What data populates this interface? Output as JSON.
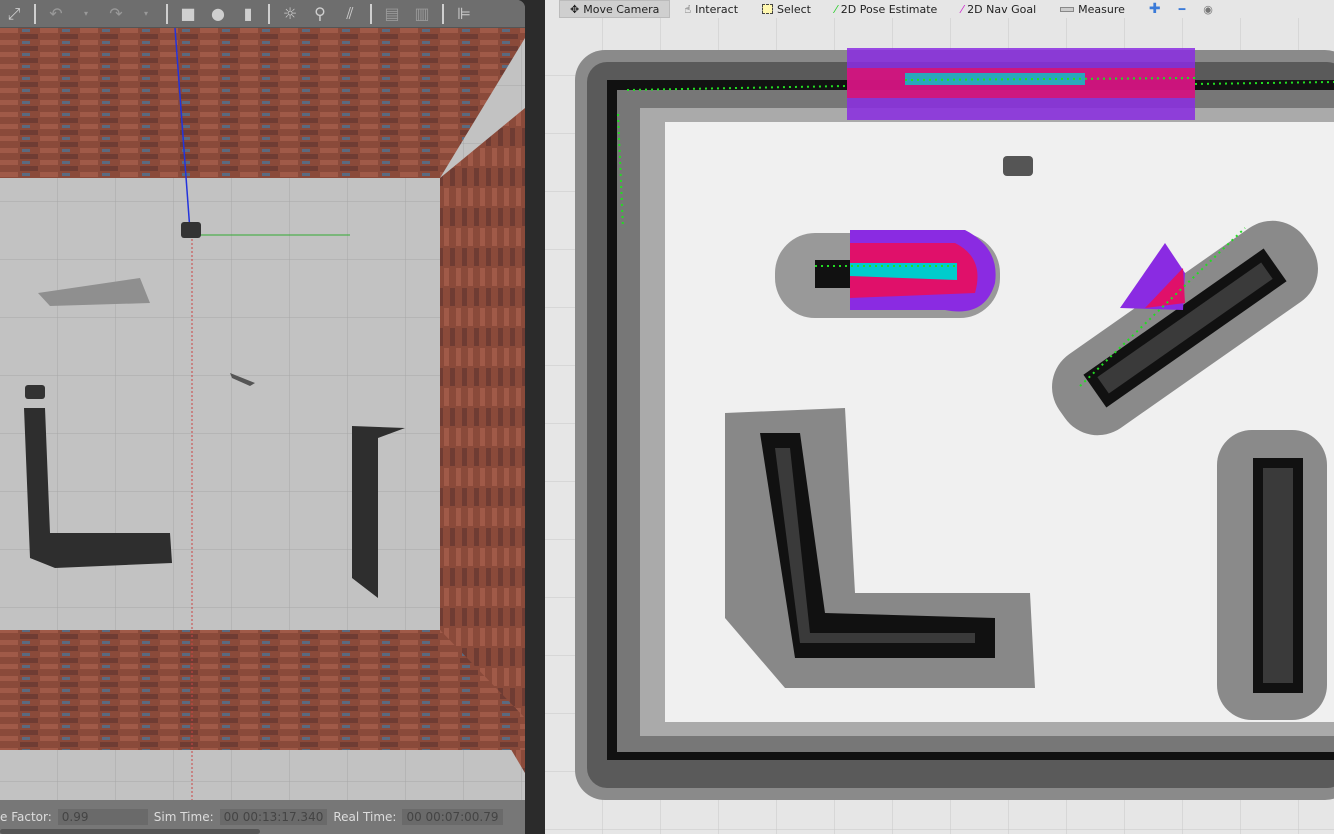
{
  "gazebo": {
    "toolbar": [
      {
        "icon": "fullscreen-icon"
      },
      {
        "icon": "undo-icon"
      },
      {
        "icon": "undo-dropdown-icon"
      },
      {
        "icon": "redo-icon"
      },
      {
        "icon": "redo-dropdown-icon"
      },
      {
        "icon": "box-icon"
      },
      {
        "icon": "sphere-icon"
      },
      {
        "icon": "cylinder-icon"
      },
      {
        "icon": "point-light-icon"
      },
      {
        "icon": "spot-light-icon"
      },
      {
        "icon": "directional-light-icon"
      },
      {
        "icon": "copy-icon"
      },
      {
        "icon": "paste-icon"
      },
      {
        "icon": "align-icon"
      }
    ],
    "status": {
      "rtf_label": "e Factor:",
      "rtf_value": "0.99",
      "sim_label": "Sim Time:",
      "sim_value": "00 00:13:17.340",
      "real_label": "Real Time:",
      "real_value": "00 00:07:00.79"
    }
  },
  "rviz": {
    "toolbar": [
      {
        "label": "Move Camera",
        "icon": "move-camera-icon",
        "active": true
      },
      {
        "label": "Interact",
        "icon": "hand-icon"
      },
      {
        "label": "Select",
        "icon": "select-icon"
      },
      {
        "label": "2D Pose Estimate",
        "icon": "pose-arrow-icon",
        "color": "#22cc22"
      },
      {
        "label": "2D Nav Goal",
        "icon": "goal-arrow-icon",
        "color": "#cc22cc"
      },
      {
        "label": "Measure",
        "icon": "ruler-icon"
      }
    ],
    "colors": {
      "costmap_high": "#ff0066",
      "costmap_mid": "#8a2be2",
      "inscribed": "#00cccc",
      "laser": "#00ff00"
    }
  }
}
